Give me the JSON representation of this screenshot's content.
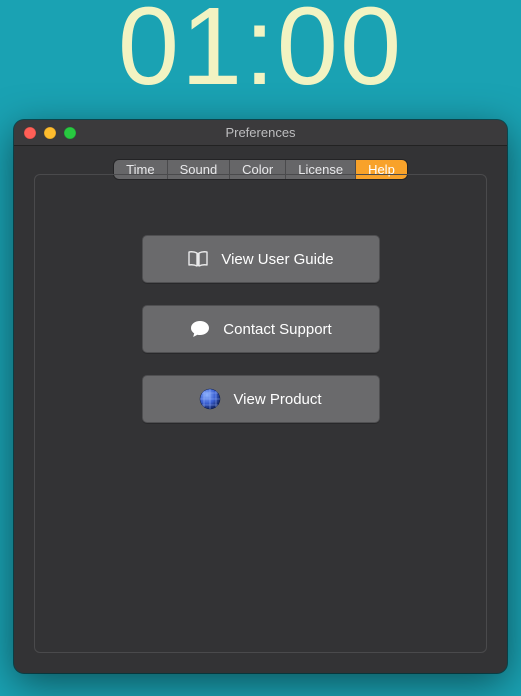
{
  "timer": {
    "display": "01:00"
  },
  "window": {
    "title": "Preferences",
    "tabs": [
      {
        "label": "Time",
        "active": false
      },
      {
        "label": "Sound",
        "active": false
      },
      {
        "label": "Color",
        "active": false
      },
      {
        "label": "License",
        "active": false
      },
      {
        "label": "Help",
        "active": true
      }
    ],
    "traffic": {
      "close": "close",
      "minimize": "minimize",
      "zoom": "zoom"
    },
    "help_panel": {
      "buttons": [
        {
          "icon": "book-icon",
          "label": "View User Guide"
        },
        {
          "icon": "chat-icon",
          "label": "Contact Support"
        },
        {
          "icon": "globe-icon",
          "label": "View Product"
        }
      ]
    }
  },
  "colors": {
    "background": "#1aa2b3",
    "timer_text": "#f2f3c2",
    "window_bg": "#333335",
    "tab_active": "#f8a22a"
  }
}
